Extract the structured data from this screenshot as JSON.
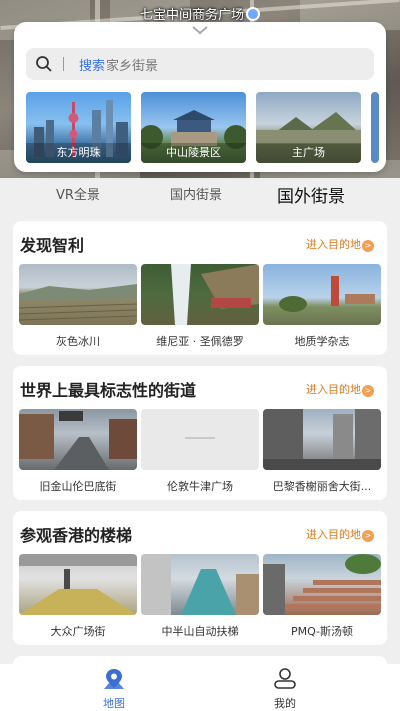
{
  "map": {
    "location_title": "七宝中间商务广场"
  },
  "search": {
    "keyword": "搜索",
    "placeholder": "家乡街景"
  },
  "scenic_spots": [
    {
      "label": "东方明珠"
    },
    {
      "label": "中山陵景区"
    },
    {
      "label": "主广场"
    }
  ],
  "tabs": [
    {
      "label": "VR全景",
      "active": false
    },
    {
      "label": "国内街景",
      "active": false
    },
    {
      "label": "国外街景",
      "active": true
    }
  ],
  "sections": [
    {
      "title": "发现智利",
      "action": "进入目的地",
      "items": [
        {
          "caption": "灰色冰川"
        },
        {
          "caption": "维尼亚 · 圣佩德罗"
        },
        {
          "caption": "地质学杂志"
        }
      ]
    },
    {
      "title": "世界上最具标志性的街道",
      "action": "进入目的地",
      "items": [
        {
          "caption": "旧金山伦巴底街"
        },
        {
          "caption": "伦敦牛津广场"
        },
        {
          "caption": "巴黎香榭丽舍大街..."
        }
      ]
    },
    {
      "title": "参观香港的楼梯",
      "action": "进入目的地",
      "items": [
        {
          "caption": "大众广场街"
        },
        {
          "caption": "中半山自动扶梯"
        },
        {
          "caption": "PMQ-斯汤顿"
        }
      ]
    }
  ],
  "bottom_nav": [
    {
      "label": "地图",
      "icon": "map-icon",
      "active": true
    },
    {
      "label": "我的",
      "icon": "profile-icon",
      "active": false
    }
  ],
  "colors": {
    "accent_blue": "#3571e6",
    "action_orange": "#d9791f"
  }
}
